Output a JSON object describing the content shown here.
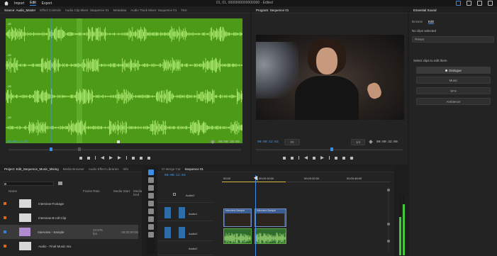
{
  "menubar": {
    "items": [
      "Import",
      "Edit",
      "Export"
    ],
    "active_index": 1,
    "doc_title": "01, 01, 0000000000000000 · Edited"
  },
  "source": {
    "tabs": [
      "Source: Audio_Master",
      "Effect Controls",
      "Audio Clip Mixer: Sequence 01",
      "Metadata",
      "Audio Track Mixer: Sequence 01",
      "Text"
    ],
    "timecode_in": "00:00:12:02",
    "timecode_out": "00:00:20:09",
    "channel_labels": [
      "-00",
      "-00",
      "-00",
      "-00"
    ],
    "waveform_color": "#4c9a15",
    "wave_color": "#b4f07a",
    "playhead_color": "#3a8ee6"
  },
  "program": {
    "tab": "Program: Sequence 01",
    "timecode_left": "00:00:12:03",
    "fit": "Fit",
    "ratio": "1/4",
    "timecode_right": "00:00:32:00"
  },
  "right_panel": {
    "tab": "Essential Sound",
    "subtabs": [
      "Browse",
      "Edit"
    ],
    "active_subtab": 1,
    "heading": "No clips selected",
    "preset_label": "Preset",
    "prompt": "Select clips to edit them",
    "buttons": [
      "Dialogue",
      "Music",
      "SFX",
      "Ambience"
    ]
  },
  "project": {
    "tabs": [
      "Project: Edit_Sequence_Music_Mixing",
      "Media Browser",
      "Audio Effect Libraries",
      "Info"
    ],
    "search_placeholder": "",
    "columns": [
      "Name",
      "Frame Rate",
      "Media Start",
      "Media End"
    ],
    "rows": [
      {
        "color": "#d9681c",
        "name": "Interview-Footage",
        "frame": "",
        "start": "",
        "selected": false
      },
      {
        "color": "#d9681c",
        "name": "Interview-B-roll-Clip",
        "frame": "",
        "start": "",
        "selected": false
      },
      {
        "color": "#3a7fd8",
        "name": "Interview - Sample",
        "frame": "23.976 fps",
        "start": "00:00:00:00",
        "selected": true
      },
      {
        "color": "#d9681c",
        "name": "Audio - Final Music mix",
        "frame": "",
        "start": "",
        "selected": false
      }
    ]
  },
  "timeline": {
    "tabs": [
      "Cl Merge Cut",
      "Sequence 01"
    ],
    "timecode": "00:00:12:03",
    "ruler": [
      "00:00",
      "00:00:16:00",
      "00:00:32:00",
      "00:00:48:00"
    ],
    "track_labels": [
      "Audio1",
      "Audio1",
      "Audio2",
      "Audio2"
    ],
    "clip_labels": [
      "Interview-Sample",
      "Interview-Sample"
    ]
  }
}
